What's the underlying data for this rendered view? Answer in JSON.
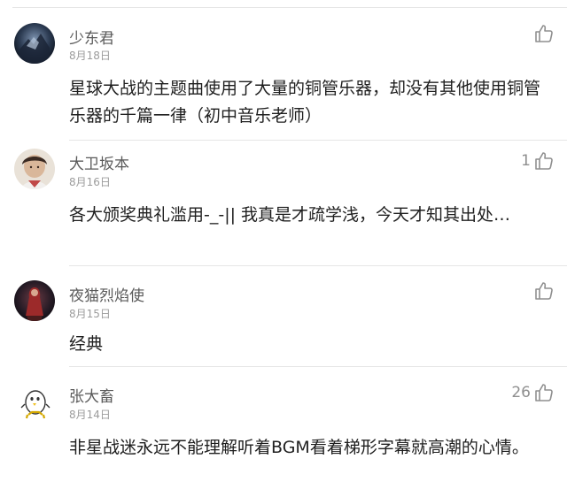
{
  "comments": [
    {
      "username": "少东君",
      "date": "8月18日",
      "likes": "",
      "text": "星球大战的主题曲使用了大量的铜管乐器，却没有其他使用铜管乐器的千篇一律（初中音乐老师）",
      "avatar_icon": "dark-blue-fantasy-avatar"
    },
    {
      "username": "大卫坂本",
      "date": "8月16日",
      "likes": "1",
      "text": "各大颁奖典礼滥用-_-||   我真是才疏学浅，今天才知其出处…",
      "avatar_icon": "photo-portrait-avatar"
    },
    {
      "username": "夜猫烈焰使",
      "date": "8月15日",
      "likes": "",
      "text": "经典",
      "avatar_icon": "red-dark-character-avatar"
    },
    {
      "username": "张大畜",
      "date": "8月14日",
      "likes": "26",
      "text": "非星战迷永远不能理解听着BGM看着梯形字幕就高潮的心情。",
      "avatar_icon": "cartoon-penguin-avatar"
    }
  ],
  "colors": {
    "username": "#5a5a5a",
    "date": "#9c9c9c",
    "text": "#1f1f1f",
    "like_icon": "#8f8f8f",
    "divider": "#e6e6e6"
  }
}
